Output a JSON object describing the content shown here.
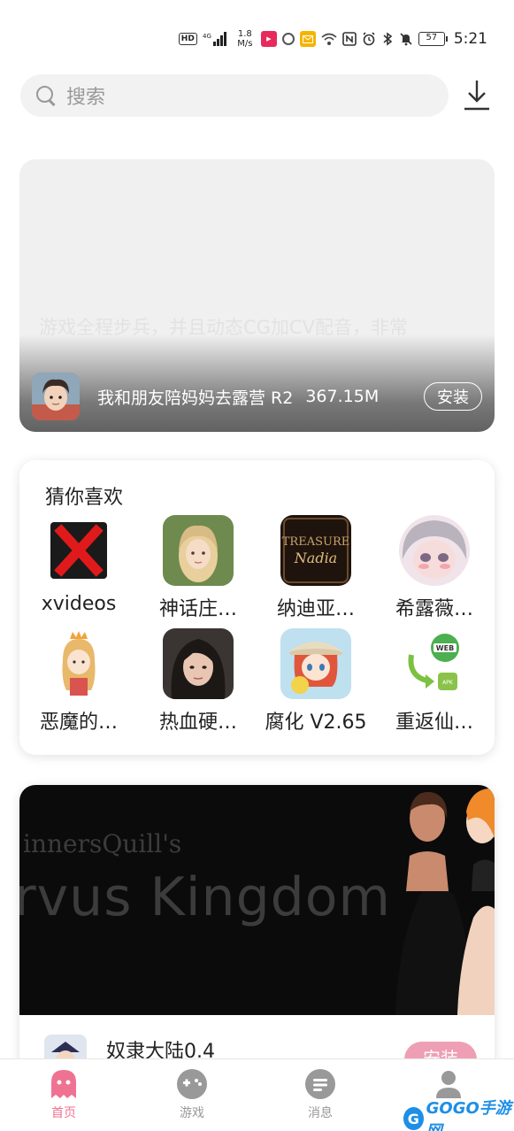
{
  "status_bar": {
    "hd": "HD",
    "network": "4G",
    "speed": "1.8\nM/s",
    "battery": "57",
    "time": "5:21"
  },
  "search": {
    "placeholder": "搜索"
  },
  "banner": {
    "description": "游戏全程步兵，并且动态CG加CV配音，非常",
    "description2": "",
    "game_title": "我和朋友陪妈妈去露营 R2",
    "size": "367.15M",
    "install_label": "安装"
  },
  "recommend": {
    "heading": "猜你喜欢",
    "items": [
      {
        "label": "xvideos",
        "icon": "red-x-icon"
      },
      {
        "label": "神话庄…",
        "icon": "blonde-girl-icon"
      },
      {
        "label": "纳迪亚…",
        "icon": "treasure-nadia-icon"
      },
      {
        "label": "希露薇…",
        "icon": "anime-girl-icon"
      },
      {
        "label": "恶魔的…",
        "icon": "princess-chibi-icon"
      },
      {
        "label": "热血硬…",
        "icon": "dark-hair-girl-icon"
      },
      {
        "label": "腐化 V2.65",
        "icon": "explorer-girl-icon"
      },
      {
        "label": "重返仙…",
        "icon": "web-apk-icon"
      }
    ]
  },
  "featured": {
    "art_line1": "innersQuill's",
    "art_line2": "rvus Kingdom",
    "game_name": "奴隶大陆0.4",
    "install_label": "安装"
  },
  "nav": {
    "tabs": [
      {
        "label": "首页",
        "active": true
      },
      {
        "label": "游戏",
        "active": false
      },
      {
        "label": "消息",
        "active": false
      },
      {
        "label": "",
        "active": false
      }
    ]
  },
  "watermark": {
    "brand": "GOGO手游网",
    "sub": "www.gogo.cn"
  },
  "colors": {
    "accent": "#f07292",
    "install_pink": "#ee9fb4",
    "inactive": "#999999"
  }
}
